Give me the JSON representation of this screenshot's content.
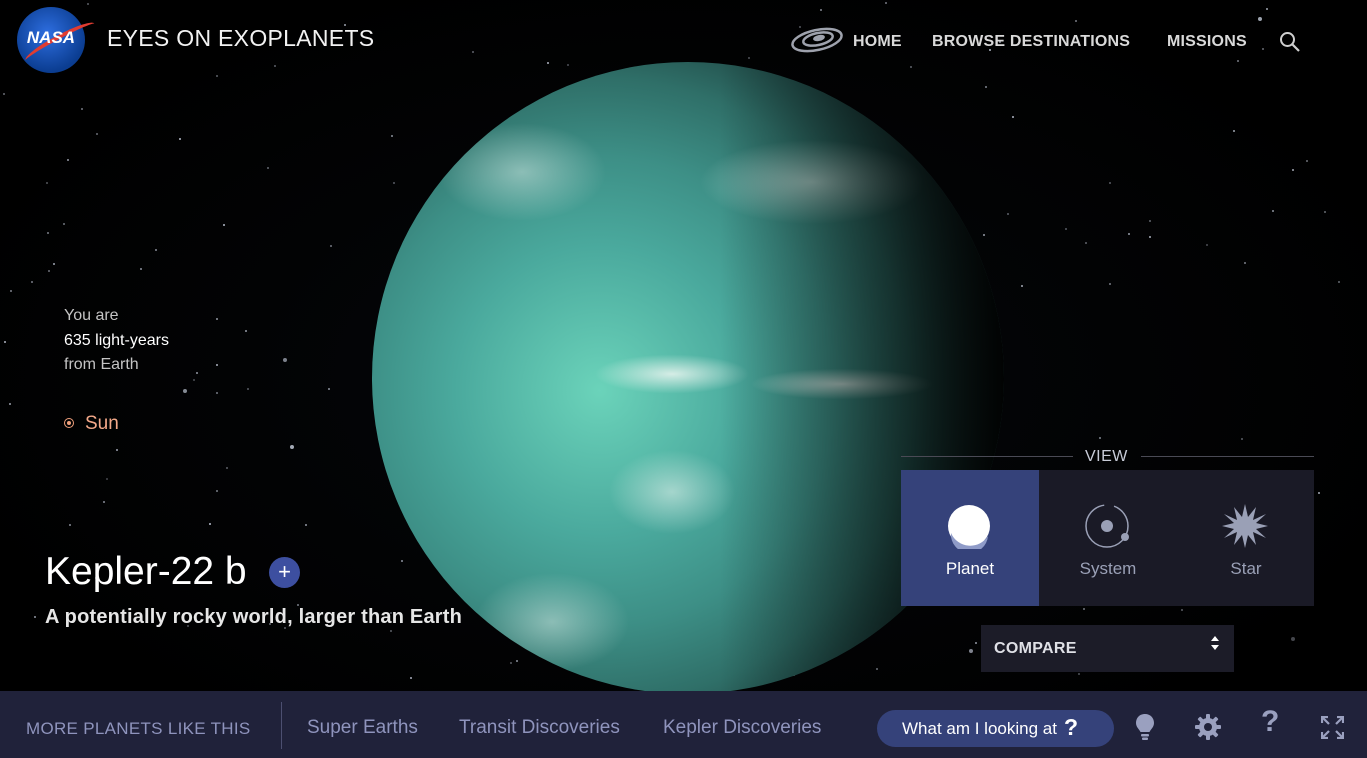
{
  "header": {
    "logo_text": "NASA",
    "app_title": "EYES ON EXOPLANETS",
    "nav": [
      {
        "label": "HOME"
      },
      {
        "label": "BROWSE DESTINATIONS"
      },
      {
        "label": "MISSIONS"
      }
    ]
  },
  "distance": {
    "line1": "You are",
    "line2": "635 light-years",
    "line3": "from Earth"
  },
  "sun_label": "Sun",
  "planet": {
    "name": "Kepler-22 b",
    "add_symbol": "+",
    "subtitle": "A potentially rocky world, larger than Earth"
  },
  "view": {
    "label": "VIEW",
    "options": [
      {
        "label": "Planet",
        "icon": "planet-icon",
        "active": true
      },
      {
        "label": "System",
        "icon": "system-icon",
        "active": false
      },
      {
        "label": "Star",
        "icon": "star-icon",
        "active": false
      }
    ]
  },
  "compare": {
    "label": "COMPARE"
  },
  "footer": {
    "more_label": "MORE PLANETS LIKE THIS",
    "links": [
      {
        "label": "Super Earths"
      },
      {
        "label": "Transit Discoveries"
      },
      {
        "label": "Kepler Discoveries"
      }
    ],
    "what_label": "What am I looking at",
    "what_symbol": "?",
    "icons": [
      "lightbulb-icon",
      "gear-icon",
      "help-icon",
      "fullscreen-icon"
    ]
  },
  "colors": {
    "footer_bg": "#20223a",
    "accent": "#35427a",
    "sun": "#f3a989"
  }
}
